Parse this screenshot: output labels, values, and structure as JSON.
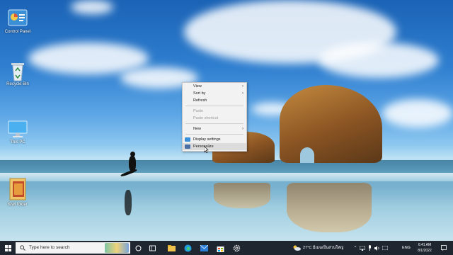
{
  "desktop": {
    "icons": [
      {
        "label": "Control Panel",
        "icon": "control-panel-icon"
      },
      {
        "label": "Recycle Bin",
        "icon": "recycle-bin-icon"
      },
      {
        "label": "This PC",
        "icon": "this-pc-icon"
      },
      {
        "label": "Kiwi folder",
        "icon": "folder-icon"
      }
    ]
  },
  "context_menu": {
    "items": [
      {
        "label": "View",
        "has_submenu": true,
        "enabled": true
      },
      {
        "label": "Sort by",
        "has_submenu": true,
        "enabled": true
      },
      {
        "label": "Refresh",
        "has_submenu": false,
        "enabled": true
      },
      {
        "label": "Paste",
        "has_submenu": false,
        "enabled": false
      },
      {
        "label": "Paste shortcut",
        "has_submenu": false,
        "enabled": false
      },
      {
        "label": "New",
        "has_submenu": true,
        "enabled": true
      },
      {
        "label": "Display settings",
        "has_submenu": false,
        "enabled": true,
        "icon": "display-settings-icon"
      },
      {
        "label": "Personalize",
        "has_submenu": false,
        "enabled": true,
        "icon": "personalize-icon",
        "hovered": true
      }
    ],
    "submenu_arrow": "›"
  },
  "taskbar": {
    "search_placeholder": "Type here to search",
    "weather": "27°C มีเมฆเป็นส่วนใหญ่",
    "language": "ENG",
    "time": "6:41 AM",
    "date": "8/1/2022",
    "apps": [
      "task-view-icon",
      "widgets-icon",
      "file-explorer-icon",
      "edge-icon",
      "mail-icon",
      "store-icon",
      "settings-icon"
    ]
  },
  "colors": {
    "taskbar_bg": "#1f2630",
    "menu_bg": "#f2f2f2",
    "accent": "#0078d7"
  }
}
